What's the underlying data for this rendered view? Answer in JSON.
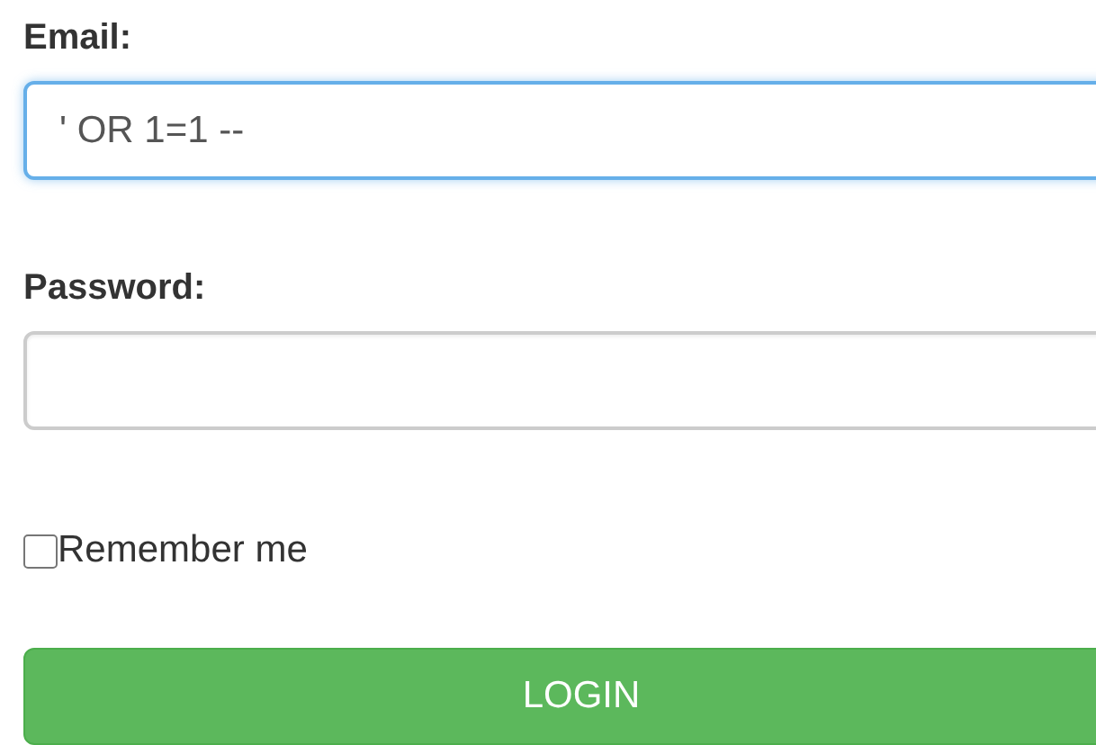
{
  "email": {
    "label": "Email:",
    "value": "' OR 1=1 --",
    "focused": true
  },
  "password": {
    "label": "Password:",
    "focused": false
  },
  "remember": {
    "label": "Remember me",
    "checked": false
  },
  "button": {
    "label": "LOGIN"
  }
}
